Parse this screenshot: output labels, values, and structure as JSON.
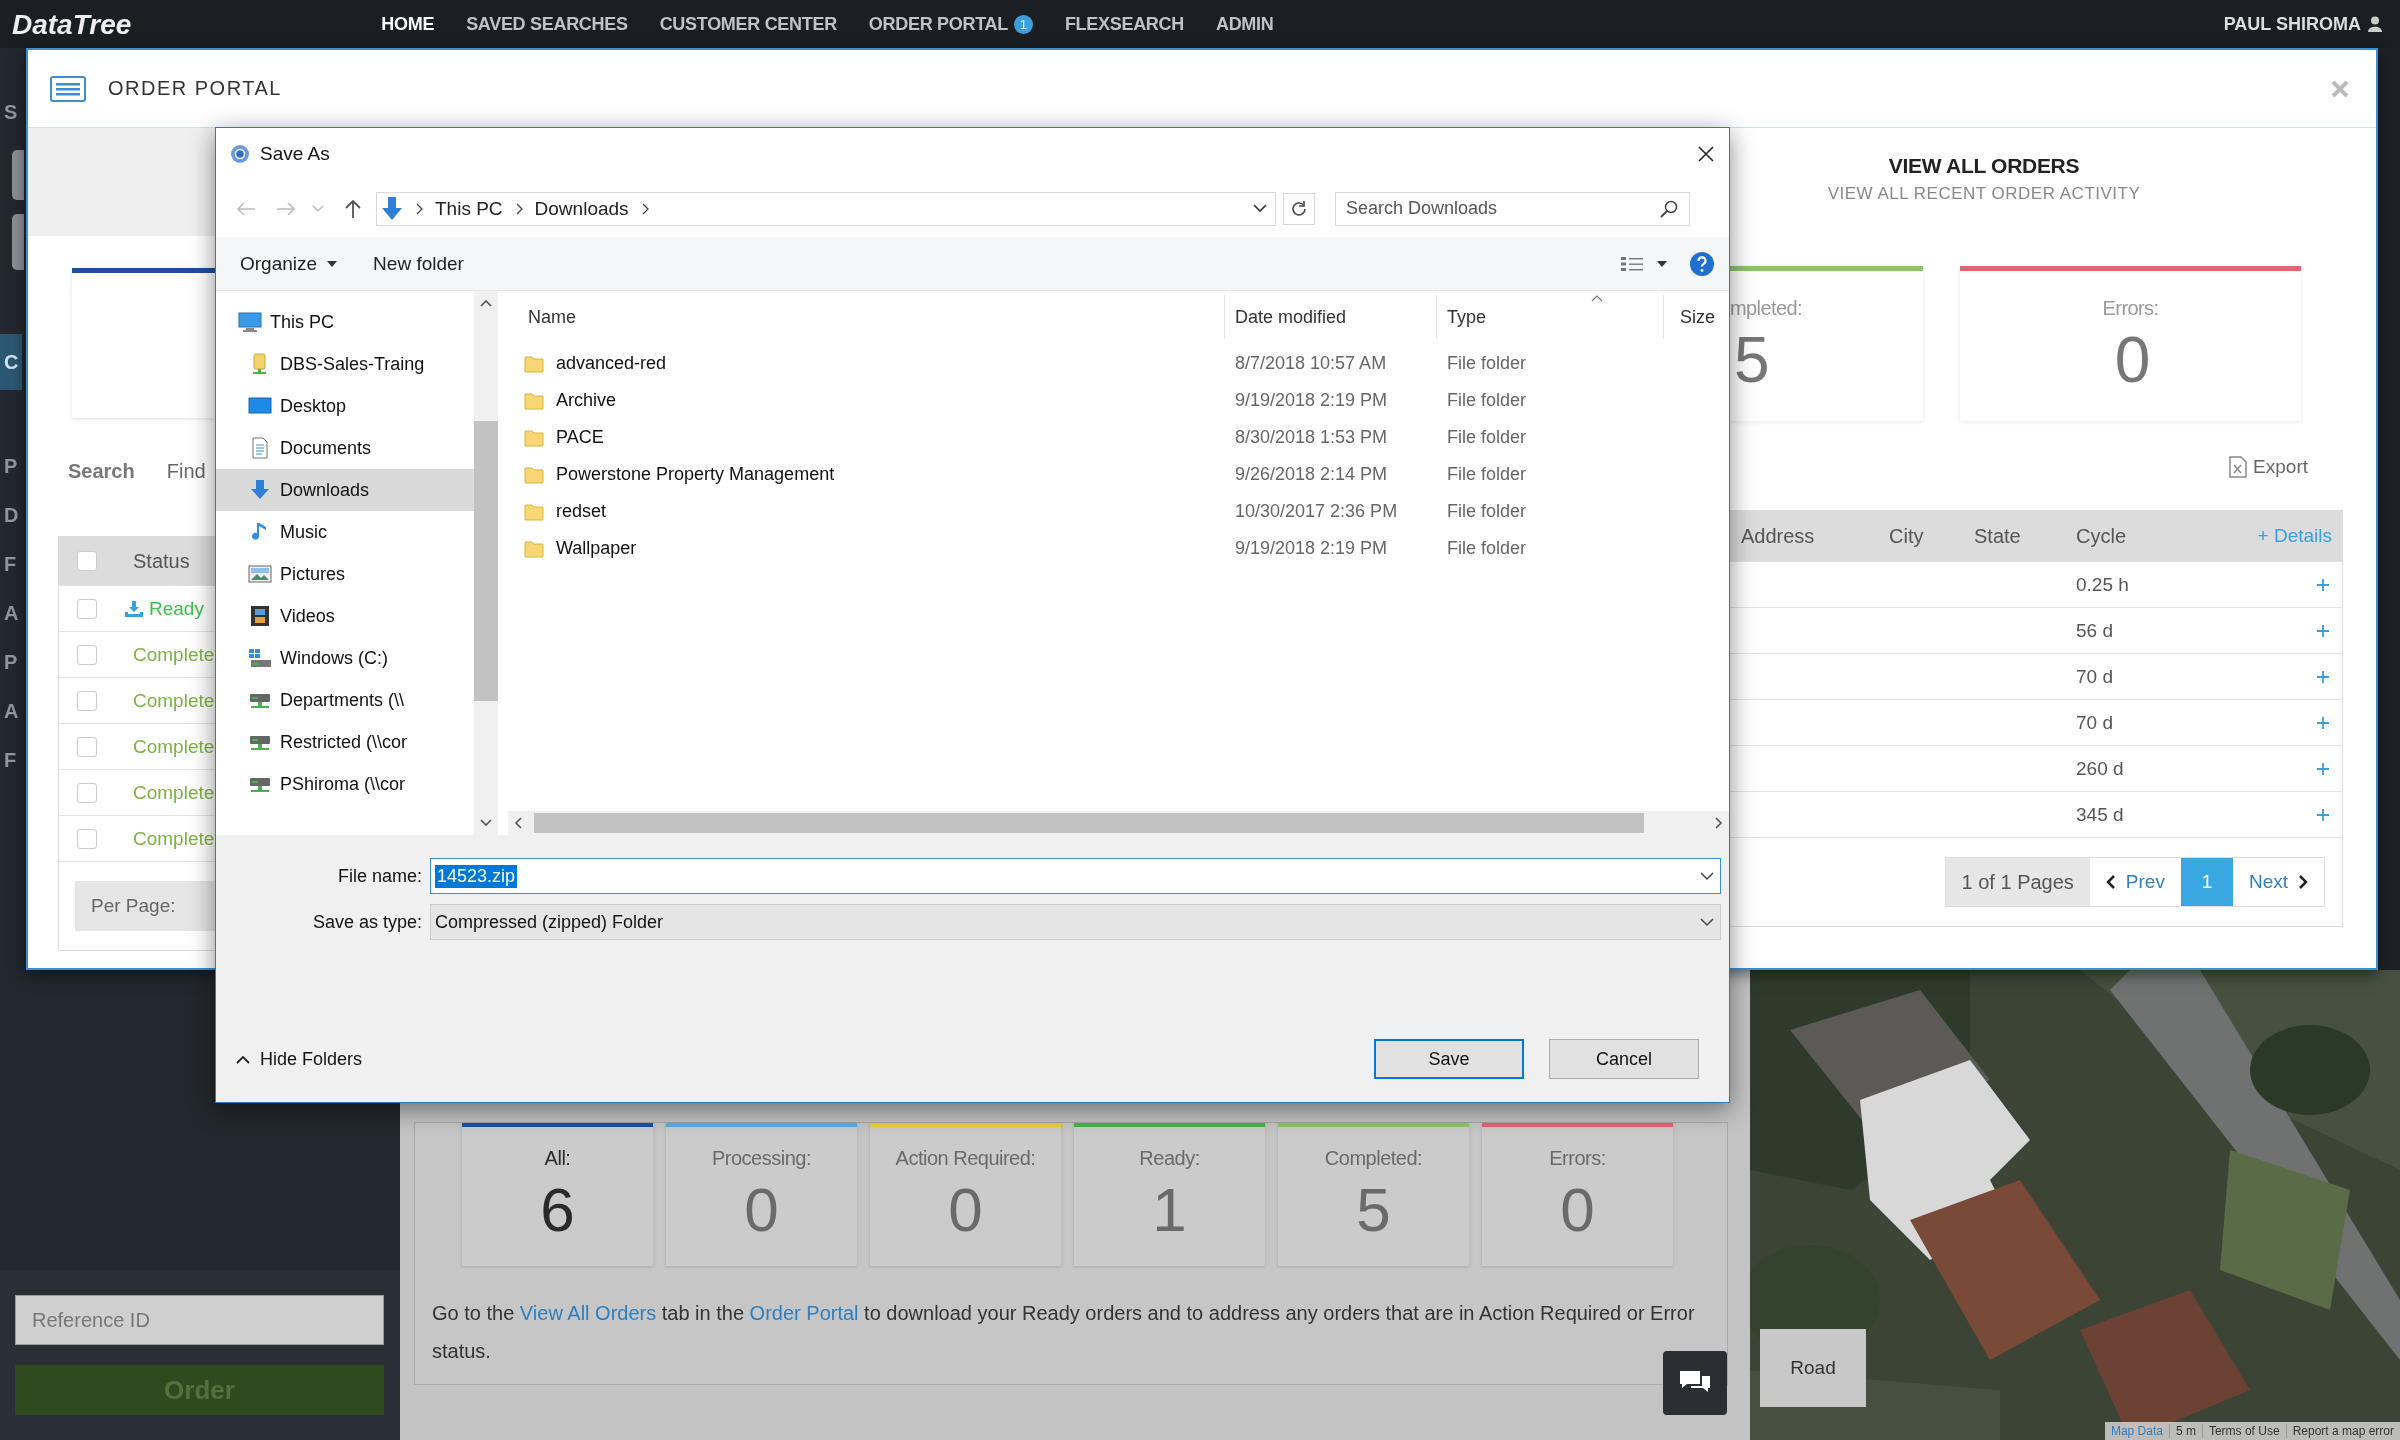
{
  "top_bar": {
    "logo": "DataTree",
    "nav": [
      {
        "label": "HOME",
        "selected": true
      },
      {
        "label": "SAVED SEARCHES",
        "selected": false
      },
      {
        "label": "CUSTOMER CENTER",
        "selected": false
      },
      {
        "label": "ORDER PORTAL",
        "selected": false,
        "badge": "1"
      },
      {
        "label": "FLEXSEARCH",
        "selected": false
      },
      {
        "label": "ADMIN",
        "selected": false
      }
    ],
    "user": "PAUL SHIROMA"
  },
  "sidebar": {
    "items": [
      {
        "label": "S",
        "selected": false
      },
      {
        "label": "C",
        "selected": true
      },
      {
        "label": "P",
        "selected": false
      },
      {
        "label": "D",
        "selected": false
      },
      {
        "label": "F",
        "selected": false
      },
      {
        "label": "A",
        "selected": false
      },
      {
        "label": "P",
        "selected": false
      },
      {
        "label": "A",
        "selected": false
      },
      {
        "label": "F",
        "selected": false
      }
    ],
    "reference_field": {
      "placeholder": "Reference ID"
    },
    "order_button": "Order"
  },
  "summary": {
    "cards": [
      {
        "label": "All:",
        "count": "6",
        "color": "#1f4e9c",
        "selected": true
      },
      {
        "label": "Processing:",
        "count": "0",
        "color": "#5aaee0",
        "selected": false
      },
      {
        "label": "Action Required:",
        "count": "0",
        "color": "#e8cf3a",
        "selected": false
      },
      {
        "label": "Ready:",
        "count": "1",
        "color": "#4caf50",
        "selected": false
      },
      {
        "label": "Completed:",
        "count": "5",
        "color": "#8cc56e",
        "selected": false
      },
      {
        "label": "Errors:",
        "count": "0",
        "color": "#e06670",
        "selected": false
      }
    ],
    "note": [
      {
        "kind": "text",
        "text": "Go to the "
      },
      {
        "kind": "link",
        "text": "View All Orders"
      },
      {
        "kind": "text",
        "text": " tab in the "
      },
      {
        "kind": "link",
        "text": "Order Portal"
      },
      {
        "kind": "text",
        "text": " to download your Ready orders and to address any orders that are in Action Required or Error status."
      }
    ]
  },
  "map": {
    "kind": "picture",
    "road_button": "Road",
    "attribution": [
      "Map Data",
      "5 m",
      "Terms of Use",
      "Report a map error"
    ]
  },
  "order_portal": {
    "title": "ORDER PORTAL",
    "all_checked": false,
    "search_label": "Search",
    "find_label": "Find",
    "status_header": "Status",
    "per_page_label": "Per Page:",
    "heading": "VIEW ALL ORDERS",
    "subheading": "VIEW ALL RECENT ORDER ACTIVITY",
    "cards": [
      {
        "label": "mpleted:",
        "count": "5",
        "color": "#8cc56e"
      },
      {
        "label": "Errors:",
        "count": "0",
        "color": "#e06670"
      }
    ],
    "export": "Export",
    "columns": [
      "Address",
      "City",
      "State",
      "Cycle"
    ],
    "details": "+ Details",
    "rows": [
      {
        "checked": false,
        "kind": "ready",
        "status": "Ready",
        "cycle": "0.25 h"
      },
      {
        "checked": false,
        "kind": "complete",
        "status": "Complete",
        "cycle": "56 d"
      },
      {
        "checked": false,
        "kind": "complete",
        "status": "Complete",
        "cycle": "70 d"
      },
      {
        "checked": false,
        "kind": "complete",
        "status": "Complete",
        "cycle": "70 d"
      },
      {
        "checked": false,
        "kind": "complete",
        "status": "Complete",
        "cycle": "260 d"
      },
      {
        "checked": false,
        "kind": "complete",
        "status": "Complete",
        "cycle": "345 d"
      }
    ],
    "pagination": {
      "summary": "1 of 1 Pages",
      "prev": "Prev",
      "pages": [
        {
          "label": "1",
          "selected": true
        }
      ],
      "next": "Next"
    }
  },
  "save_dialog": {
    "title": "Save As",
    "path": [
      "This PC",
      "Downloads"
    ],
    "search": {
      "placeholder": "Search Downloads"
    },
    "organize": "Organize",
    "new_folder": "New folder",
    "nav": [
      {
        "label": "This PC",
        "kind": "pc",
        "selected": false,
        "children": [
          {
            "label": "DBS-Sales-Traing",
            "kind": "user-drive",
            "selected": false
          },
          {
            "label": "Desktop",
            "kind": "desktop",
            "selected": false
          },
          {
            "label": "Documents",
            "kind": "documents",
            "selected": false
          },
          {
            "label": "Downloads",
            "kind": "downloads",
            "selected": true
          },
          {
            "label": "Music",
            "kind": "music",
            "selected": false
          },
          {
            "label": "Pictures",
            "kind": "pictures",
            "selected": false
          },
          {
            "label": "Videos",
            "kind": "videos",
            "selected": false
          },
          {
            "label": "Windows (C:)",
            "kind": "windows-drive",
            "selected": false
          },
          {
            "label": "Departments (\\\\",
            "kind": "network-drive",
            "selected": false
          },
          {
            "label": "Restricted (\\\\cor",
            "kind": "network-drive",
            "selected": false
          },
          {
            "label": "PShiroma (\\\\cor",
            "kind": "network-drive",
            "selected": false
          }
        ]
      }
    ],
    "columns": [
      {
        "label": "Name",
        "sorted": false
      },
      {
        "label": "Date modified",
        "sorted": false
      },
      {
        "label": "Type",
        "sorted": true
      },
      {
        "label": "Size",
        "sorted": false
      }
    ],
    "files": [
      {
        "name": "advanced-red",
        "date": "8/7/2018 10:57 AM",
        "type": "File folder"
      },
      {
        "name": "Archive",
        "date": "9/19/2018 2:19 PM",
        "type": "File folder"
      },
      {
        "name": "PACE",
        "date": "8/30/2018 1:53 PM",
        "type": "File folder"
      },
      {
        "name": "Powerstone Property Management",
        "date": "9/26/2018 2:14 PM",
        "type": "File folder"
      },
      {
        "name": "redset",
        "date": "10/30/2017 2:36 PM",
        "type": "File folder"
      },
      {
        "name": "Wallpaper",
        "date": "9/19/2018 2:19 PM",
        "type": "File folder"
      }
    ],
    "file_name_label": "File name:",
    "file_name": "14523.zip",
    "save_type_label": "Save as type:",
    "save_type": "Compressed (zipped) Folder",
    "hide_folders": "Hide Folders",
    "buttons": [
      {
        "label": "Save",
        "kind": "primary"
      },
      {
        "label": "Cancel",
        "kind": "secondary"
      }
    ]
  }
}
